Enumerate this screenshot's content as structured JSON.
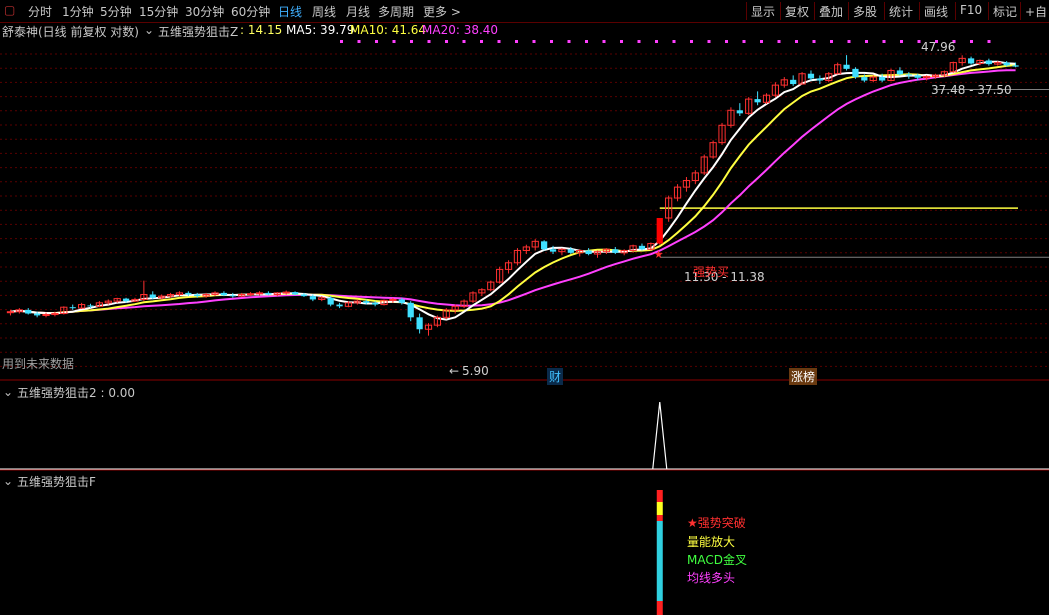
{
  "toolbar": {
    "periods": [
      "分时",
      "1分钟",
      "5分钟",
      "15分钟",
      "30分钟",
      "60分钟",
      "日线",
      "周线",
      "月线",
      "多周期",
      "更多 >"
    ],
    "active_period": "日线",
    "right_buttons": [
      "显示",
      "复权",
      "叠加",
      "多股",
      "统计",
      "画线",
      "F10",
      "标记",
      "+自"
    ]
  },
  "main_panel": {
    "stock_name": "舒泰神(日线 前复权 对数)",
    "indicator_name": "五维强势狙击Z",
    "indicator_value": ": 14.15",
    "ma5_label": "MA5: 39.79",
    "ma10_label": "MA10: 41.64",
    "ma20_label": "MA20: 38.40",
    "high_label": "47.96",
    "range_label": "37.48 - 37.50",
    "mid_range_label": "11.30 - 11.38",
    "low_label": "5.90",
    "future_text": "用到未来数据",
    "signal_text": "强势买",
    "badge_cai": "财",
    "badge_zhangbang": "涨榜"
  },
  "sub_panel_1": {
    "title": "五维强势狙击2",
    "value": ": 0.00"
  },
  "sub_panel_2": {
    "title": "五维强势狙击F",
    "signals": [
      {
        "text": "★强势突破",
        "color": "#ff3030"
      },
      {
        "text": "量能放大",
        "color": "#ffff40"
      },
      {
        "text": "MACD金叉",
        "color": "#40ff40"
      },
      {
        "text": "均线多头",
        "color": "#ff40ff"
      }
    ]
  },
  "colors": {
    "up": "#ff3030",
    "down": "#40e0ff",
    "ma5": "#ffffff",
    "ma10": "#ffff40",
    "ma20": "#ff40ff",
    "grid": "#5a0000",
    "signal_red": "#ff0000"
  },
  "chart_data": {
    "type": "candlestick",
    "ylim": [
      5.0,
      52.0
    ],
    "y_scale": "log",
    "ohlc": [
      [
        7.55,
        7.7,
        7.4,
        7.6
      ],
      [
        7.6,
        7.8,
        7.5,
        7.7
      ],
      [
        7.7,
        7.8,
        7.45,
        7.5
      ],
      [
        7.5,
        7.6,
        7.3,
        7.4
      ],
      [
        7.4,
        7.55,
        7.3,
        7.45
      ],
      [
        7.45,
        7.6,
        7.35,
        7.5
      ],
      [
        7.5,
        7.9,
        7.45,
        7.85
      ],
      [
        7.85,
        8.0,
        7.7,
        7.8
      ],
      [
        7.8,
        8.1,
        7.75,
        8.0
      ],
      [
        7.95,
        8.05,
        7.8,
        7.9
      ],
      [
        7.9,
        8.2,
        7.85,
        8.1
      ],
      [
        8.1,
        8.3,
        8.0,
        8.2
      ],
      [
        8.2,
        8.4,
        8.1,
        8.35
      ],
      [
        8.35,
        8.4,
        8.1,
        8.2
      ],
      [
        8.2,
        8.4,
        8.15,
        8.3
      ],
      [
        8.3,
        9.5,
        8.2,
        8.6
      ],
      [
        8.6,
        8.8,
        8.3,
        8.4
      ],
      [
        8.4,
        8.6,
        8.3,
        8.5
      ],
      [
        8.5,
        8.7,
        8.4,
        8.6
      ],
      [
        8.6,
        8.8,
        8.5,
        8.7
      ],
      [
        8.7,
        8.8,
        8.5,
        8.6
      ],
      [
        8.6,
        8.7,
        8.4,
        8.5
      ],
      [
        8.5,
        8.7,
        8.4,
        8.6
      ],
      [
        8.6,
        8.8,
        8.5,
        8.7
      ],
      [
        8.7,
        8.8,
        8.5,
        8.55
      ],
      [
        8.55,
        8.7,
        8.4,
        8.5
      ],
      [
        8.5,
        8.7,
        8.45,
        8.6
      ],
      [
        8.6,
        8.75,
        8.5,
        8.65
      ],
      [
        8.65,
        8.8,
        8.55,
        8.7
      ],
      [
        8.7,
        8.8,
        8.55,
        8.6
      ],
      [
        8.6,
        8.75,
        8.5,
        8.7
      ],
      [
        8.7,
        8.85,
        8.6,
        8.75
      ],
      [
        8.75,
        8.8,
        8.55,
        8.6
      ],
      [
        8.6,
        8.7,
        8.45,
        8.5
      ],
      [
        8.5,
        8.6,
        8.2,
        8.3
      ],
      [
        8.3,
        8.5,
        8.2,
        8.4
      ],
      [
        8.4,
        8.5,
        7.9,
        8.0
      ],
      [
        8.0,
        8.1,
        7.8,
        7.9
      ],
      [
        7.9,
        8.2,
        7.85,
        8.1
      ],
      [
        8.1,
        8.3,
        8.0,
        8.2
      ],
      [
        8.2,
        8.3,
        8.0,
        8.1
      ],
      [
        8.1,
        8.2,
        7.9,
        8.0
      ],
      [
        8.0,
        8.3,
        7.95,
        8.25
      ],
      [
        8.25,
        8.4,
        8.1,
        8.3
      ],
      [
        8.3,
        8.4,
        8.0,
        8.1
      ],
      [
        8.1,
        8.2,
        7.1,
        7.3
      ],
      [
        7.3,
        7.5,
        6.5,
        6.7
      ],
      [
        6.7,
        7.0,
        6.4,
        6.9
      ],
      [
        6.9,
        7.4,
        6.8,
        7.3
      ],
      [
        7.3,
        7.8,
        7.2,
        7.7
      ],
      [
        7.7,
        8.0,
        7.5,
        7.9
      ],
      [
        7.9,
        8.3,
        7.8,
        8.2
      ],
      [
        8.2,
        8.8,
        8.1,
        8.7
      ],
      [
        8.7,
        9.0,
        8.5,
        8.9
      ],
      [
        8.9,
        9.5,
        8.8,
        9.4
      ],
      [
        9.4,
        10.5,
        9.3,
        10.3
      ],
      [
        10.3,
        11.0,
        10.0,
        10.8
      ],
      [
        10.8,
        12.0,
        10.6,
        11.8
      ],
      [
        11.8,
        12.3,
        11.5,
        12.1
      ],
      [
        12.1,
        12.8,
        11.8,
        12.6
      ],
      [
        12.6,
        12.7,
        11.8,
        11.9
      ],
      [
        11.9,
        12.2,
        11.5,
        11.7
      ],
      [
        11.7,
        12.0,
        11.4,
        11.9
      ],
      [
        11.9,
        12.1,
        11.5,
        11.6
      ],
      [
        11.6,
        11.9,
        11.3,
        11.8
      ],
      [
        11.8,
        12.0,
        11.4,
        11.5
      ],
      [
        11.5,
        11.8,
        11.2,
        11.7
      ],
      [
        11.7,
        12.0,
        11.5,
        11.9
      ],
      [
        11.9,
        12.1,
        11.5,
        11.6
      ],
      [
        11.6,
        11.9,
        11.4,
        11.8
      ],
      [
        11.8,
        12.3,
        11.6,
        12.2
      ],
      [
        12.2,
        12.4,
        11.8,
        11.9
      ],
      [
        11.9,
        12.5,
        11.8,
        12.4
      ],
      [
        12.4,
        14.9,
        12.3,
        14.9
      ],
      [
        14.9,
        17.5,
        14.5,
        17.2
      ],
      [
        17.2,
        19.0,
        16.8,
        18.6
      ],
      [
        18.6,
        20.0,
        18.0,
        19.5
      ],
      [
        19.5,
        21.0,
        19.0,
        20.6
      ],
      [
        20.6,
        23.5,
        20.3,
        23.1
      ],
      [
        23.1,
        26.0,
        22.8,
        25.6
      ],
      [
        25.6,
        29.5,
        25.2,
        29.0
      ],
      [
        29.0,
        33.0,
        28.5,
        32.3
      ],
      [
        32.3,
        34.0,
        31.0,
        31.6
      ],
      [
        31.6,
        35.5,
        31.2,
        35.0
      ],
      [
        35.0,
        37.0,
        33.5,
        34.2
      ],
      [
        34.2,
        36.5,
        33.8,
        36.0
      ],
      [
        36.0,
        39.5,
        35.5,
        38.7
      ],
      [
        38.7,
        41.0,
        38.0,
        40.2
      ],
      [
        40.2,
        41.5,
        38.5,
        39.0
      ],
      [
        39.0,
        42.5,
        38.8,
        42.0
      ],
      [
        42.0,
        43.0,
        40.0,
        40.6
      ],
      [
        40.6,
        41.5,
        39.0,
        40.0
      ],
      [
        40.0,
        42.5,
        39.5,
        42.0
      ],
      [
        42.0,
        45.5,
        41.8,
        44.8
      ],
      [
        44.8,
        48.0,
        43.0,
        43.5
      ],
      [
        43.5,
        44.0,
        40.5,
        41.0
      ],
      [
        41.0,
        41.8,
        39.5,
        40.0
      ],
      [
        40.0,
        41.5,
        39.5,
        41.0
      ],
      [
        41.0,
        42.0,
        39.5,
        40.0
      ],
      [
        40.0,
        43.5,
        39.8,
        43.0
      ],
      [
        43.0,
        44.0,
        41.5,
        41.8
      ],
      [
        41.8,
        42.5,
        40.5,
        41.5
      ],
      [
        41.5,
        42.0,
        40.0,
        40.8
      ],
      [
        40.8,
        41.5,
        40.0,
        41.2
      ],
      [
        41.2,
        42.0,
        40.5,
        41.6
      ],
      [
        41.6,
        43.0,
        41.0,
        42.6
      ],
      [
        42.6,
        45.8,
        42.3,
        45.5
      ],
      [
        45.5,
        47.96,
        44.5,
        46.9
      ],
      [
        46.9,
        47.5,
        44.8,
        45.2
      ],
      [
        45.2,
        46.5,
        44.6,
        46.2
      ],
      [
        46.2,
        46.8,
        44.5,
        45.0
      ],
      [
        45.0,
        46.0,
        44.5,
        45.5
      ],
      [
        45.5,
        46.0,
        44.2,
        44.6
      ],
      [
        44.6,
        45.5,
        44.0,
        44.2
      ]
    ],
    "ma_series": [
      "MA5",
      "MA10",
      "MA20"
    ],
    "signal_index": 73,
    "yellow_level": 16.0
  }
}
